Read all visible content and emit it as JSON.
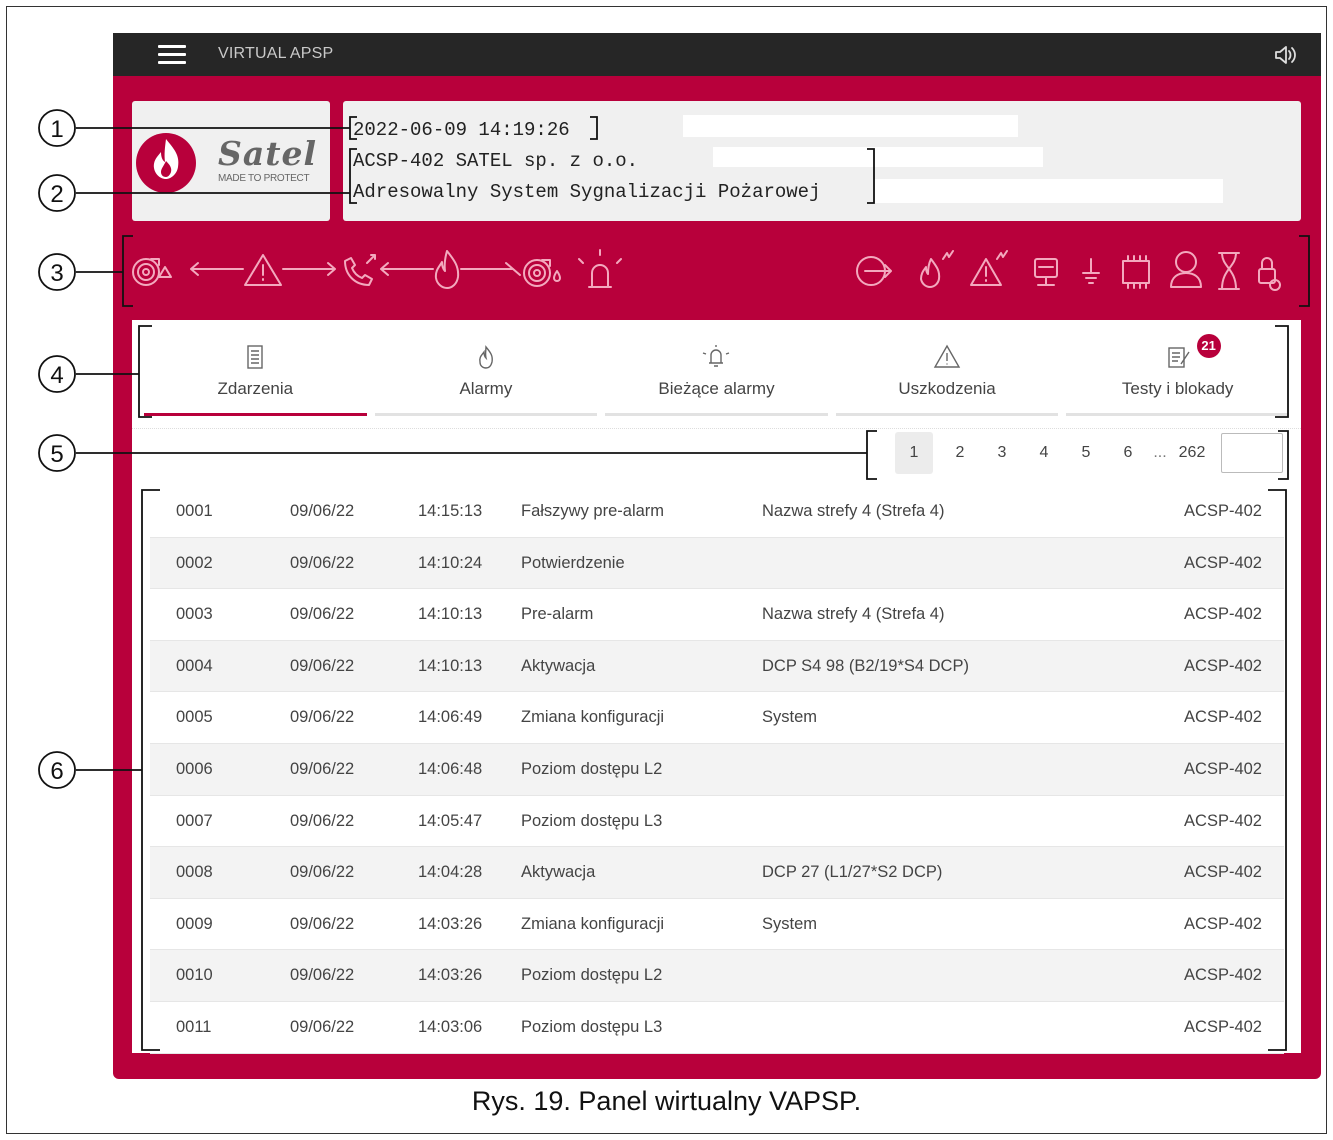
{
  "app": {
    "title": "VIRTUAL APSP",
    "brand": {
      "name": "Satel",
      "tagline": "MADE TO PROTECT"
    }
  },
  "info": {
    "datetime": "2022-06-09 14:19:26",
    "line1": "ACSP-402 SATEL sp. z o.o.",
    "line2": "Adresowalny System Sygnalizacji Pożarowej"
  },
  "status_icons": {
    "left": [
      "fire-alarm-device-icon",
      "arrow-left-icon",
      "warning-icon",
      "arrow-right-icon",
      "phone-transmission-icon",
      "arrow-left-icon",
      "flame-icon",
      "arrow-right-icon",
      "fire-protection-device-icon",
      "siren-icon"
    ],
    "right": [
      "output-icon",
      "fire-fault-icon",
      "warning-fault-icon",
      "power-supply-icon",
      "earth-ground-icon",
      "module-icon",
      "user-icon",
      "hourglass-icon",
      "lock-icon"
    ]
  },
  "tabs": [
    {
      "label": "Zdarzenia",
      "icon": "event-log-icon",
      "active": true
    },
    {
      "label": "Alarmy",
      "icon": "flame-icon",
      "active": false
    },
    {
      "label": "Bieżące alarmy",
      "icon": "alarm-bell-icon",
      "active": false
    },
    {
      "label": "Uszkodzenia",
      "icon": "warning-icon",
      "active": false
    },
    {
      "label": "Testy i blokady",
      "icon": "tests-icon",
      "active": false,
      "badge": "21"
    }
  ],
  "pagination": {
    "pages": [
      "1",
      "2",
      "3",
      "4",
      "5",
      "6"
    ],
    "ellipsis": "...",
    "last": "262",
    "current": "1"
  },
  "events": [
    {
      "no": "0001",
      "date": "09/06/22",
      "time": "14:15:13",
      "event": "Fałszywy pre-alarm",
      "source": "Nazwa strefy 4 (Strefa 4)",
      "device": "ACSP-402"
    },
    {
      "no": "0002",
      "date": "09/06/22",
      "time": "14:10:24",
      "event": "Potwierdzenie",
      "source": "",
      "device": "ACSP-402"
    },
    {
      "no": "0003",
      "date": "09/06/22",
      "time": "14:10:13",
      "event": "Pre-alarm",
      "source": "Nazwa strefy 4 (Strefa 4)",
      "device": "ACSP-402"
    },
    {
      "no": "0004",
      "date": "09/06/22",
      "time": "14:10:13",
      "event": "Aktywacja",
      "source": "DCP S4 98 (B2/19*S4 DCP)",
      "device": "ACSP-402"
    },
    {
      "no": "0005",
      "date": "09/06/22",
      "time": "14:06:49",
      "event": "Zmiana konfiguracji",
      "source": "System",
      "device": "ACSP-402"
    },
    {
      "no": "0006",
      "date": "09/06/22",
      "time": "14:06:48",
      "event": "Poziom dostępu L2",
      "source": "",
      "device": "ACSP-402"
    },
    {
      "no": "0007",
      "date": "09/06/22",
      "time": "14:05:47",
      "event": "Poziom dostępu L3",
      "source": "",
      "device": "ACSP-402"
    },
    {
      "no": "0008",
      "date": "09/06/22",
      "time": "14:04:28",
      "event": "Aktywacja",
      "source": "DCP 27 (L1/27*S2 DCP)",
      "device": "ACSP-402"
    },
    {
      "no": "0009",
      "date": "09/06/22",
      "time": "14:03:26",
      "event": "Zmiana konfiguracji",
      "source": "System",
      "device": "ACSP-402"
    },
    {
      "no": "0010",
      "date": "09/06/22",
      "time": "14:03:26",
      "event": "Poziom dostępu L2",
      "source": "",
      "device": "ACSP-402"
    },
    {
      "no": "0011",
      "date": "09/06/22",
      "time": "14:03:06",
      "event": "Poziom dostępu L3",
      "source": "",
      "device": "ACSP-402"
    }
  ],
  "callouts": [
    "1",
    "2",
    "3",
    "4",
    "5",
    "6"
  ],
  "caption": "Rys. 19. Panel wirtualny VAPSP.",
  "colors": {
    "accent": "#b8003b",
    "topbar": "#262626",
    "icon": "#f3a9be"
  }
}
